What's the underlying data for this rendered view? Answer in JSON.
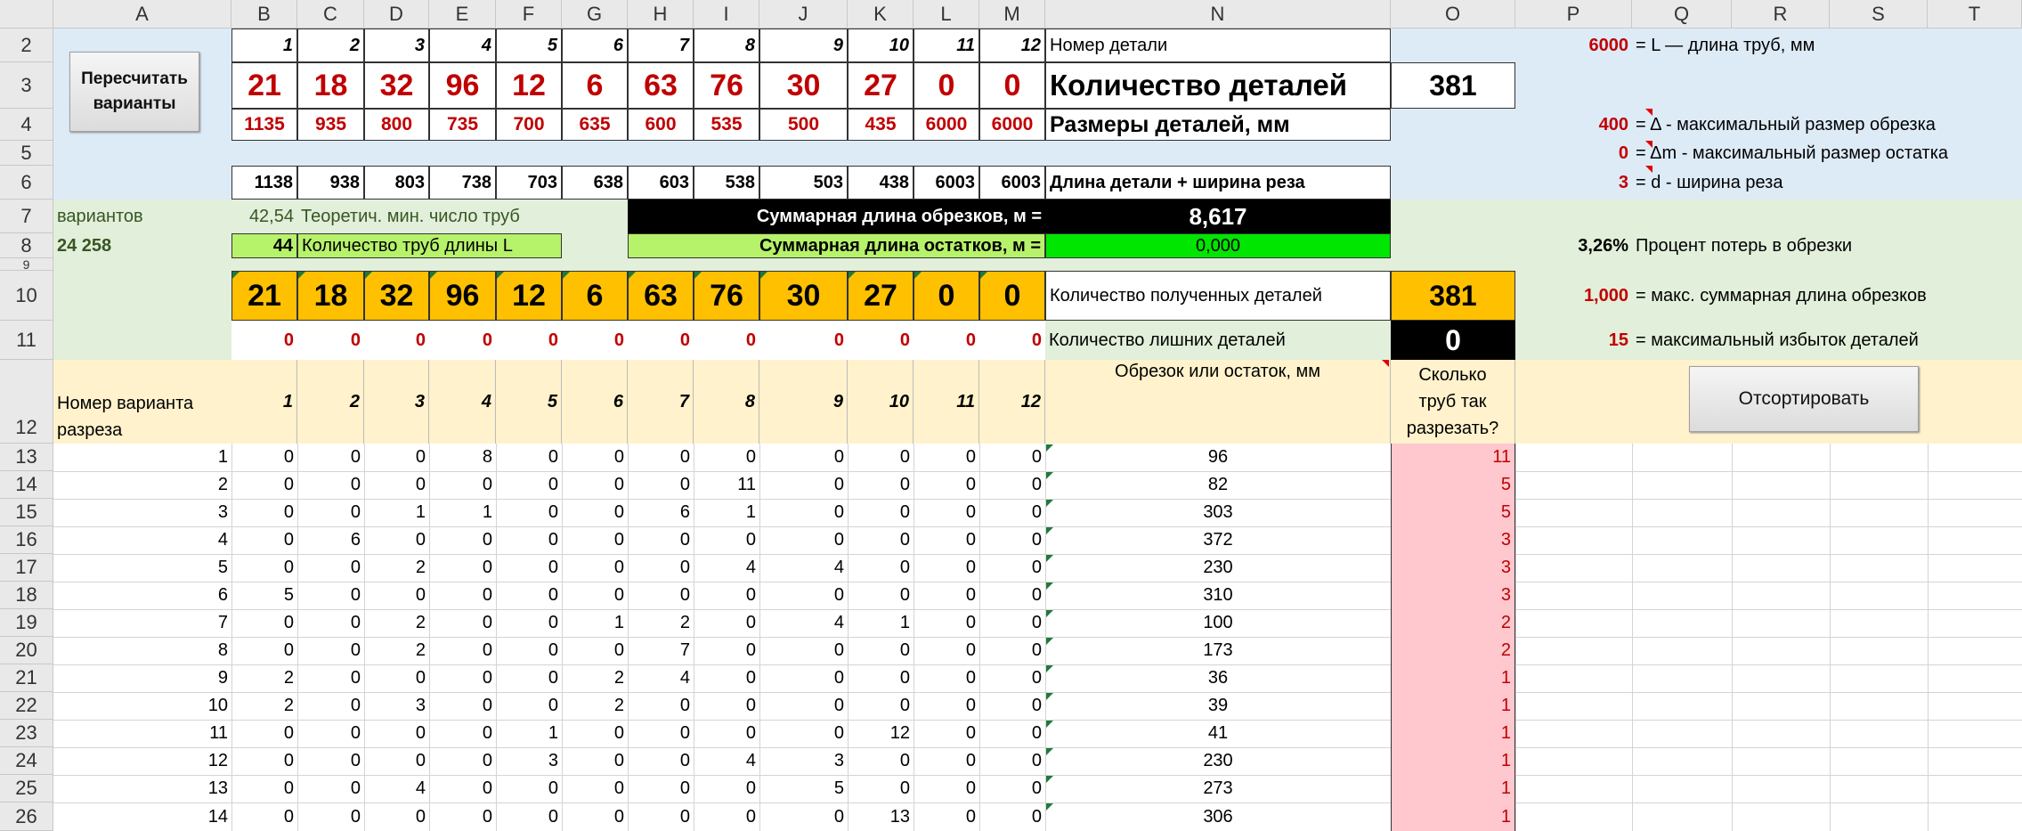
{
  "columns": [
    "A",
    "B",
    "C",
    "D",
    "E",
    "F",
    "G",
    "H",
    "I",
    "J",
    "K",
    "L",
    "M",
    "N",
    "O",
    "P",
    "Q",
    "R",
    "S",
    "T"
  ],
  "row_numbers": [
    "2",
    "3",
    "4",
    "5",
    "6",
    "7",
    "8",
    "9",
    "10",
    "11",
    "12",
    "13",
    "14",
    "15",
    "16",
    "17",
    "18",
    "19",
    "20",
    "21",
    "22",
    "23",
    "24",
    "25",
    "26"
  ],
  "buttons": {
    "recalc": "Пересчитать варианты",
    "sort": "Отсортировать"
  },
  "part_numbers": [
    "1",
    "2",
    "3",
    "4",
    "5",
    "6",
    "7",
    "8",
    "9",
    "10",
    "11",
    "12"
  ],
  "part_quantities": [
    "21",
    "18",
    "32",
    "96",
    "12",
    "6",
    "63",
    "76",
    "30",
    "27",
    "0",
    "0"
  ],
  "part_sizes": [
    "1135",
    "935",
    "800",
    "735",
    "700",
    "635",
    "600",
    "535",
    "500",
    "435",
    "6000",
    "6000"
  ],
  "part_len_kerf": [
    "1138",
    "938",
    "803",
    "738",
    "703",
    "638",
    "603",
    "538",
    "503",
    "438",
    "6003",
    "6003"
  ],
  "labels": {
    "part_number": "Номер детали",
    "part_count": "Количество деталей",
    "part_sizes": "Размеры деталей, мм",
    "len_kerf": "Длина детали + ширина реза",
    "variants_label": "вариантов",
    "variants_count": "24 258",
    "theor_value": "42,54",
    "theor_label": "Теоретич. мин. число труб",
    "pipes_value": "44",
    "pipes_label": "Количество труб длины L",
    "scrap_label": "Суммарная длина обрезков, м =",
    "scrap_value": "8,617",
    "rem_label": "Суммарная длина остатков, м =",
    "rem_value": "0,000",
    "loss_pct": "3,26%",
    "loss_label": "Процент потерь в обрезки",
    "received_label": "Количество полученных  деталей",
    "received_total": "381",
    "extra_label": "Количество лишних деталей",
    "extra_total": "0",
    "total_parts": "381"
  },
  "params": [
    {
      "value": "6000",
      "label": "= L — длина труб, мм"
    },
    {
      "value": "400",
      "label": "= Δ - максимальный размер обрезка"
    },
    {
      "value": "0",
      "label": "= Δm - максимальный размер остатка"
    },
    {
      "value": "3",
      "label": "= d - ширина реза"
    },
    {
      "value": "1,000",
      "label": "= макс. суммарная длина обрезков"
    },
    {
      "value": "15",
      "label": "= максимальный избыток деталей"
    }
  ],
  "received_counts": [
    "21",
    "18",
    "32",
    "96",
    "12",
    "6",
    "63",
    "76",
    "30",
    "27",
    "0",
    "0"
  ],
  "extra_counts": [
    "0",
    "0",
    "0",
    "0",
    "0",
    "0",
    "0",
    "0",
    "0",
    "0",
    "0",
    "0"
  ],
  "table_header": {
    "variant": "Номер варианта разреза",
    "cols": [
      "1",
      "2",
      "3",
      "4",
      "5",
      "6",
      "7",
      "8",
      "9",
      "10",
      "11",
      "12"
    ],
    "scrap": "Обрезок или остаток, мм",
    "howmany": "Сколько труб так разрезать?"
  },
  "table_rows": [
    {
      "n": "1",
      "cells": [
        "0",
        "0",
        "0",
        "8",
        "0",
        "0",
        "0",
        "0",
        "0",
        "0",
        "0",
        "0"
      ],
      "scrap": "96",
      "count": "11"
    },
    {
      "n": "2",
      "cells": [
        "0",
        "0",
        "0",
        "0",
        "0",
        "0",
        "0",
        "11",
        "0",
        "0",
        "0",
        "0"
      ],
      "scrap": "82",
      "count": "5"
    },
    {
      "n": "3",
      "cells": [
        "0",
        "0",
        "1",
        "1",
        "0",
        "0",
        "6",
        "1",
        "0",
        "0",
        "0",
        "0"
      ],
      "scrap": "303",
      "count": "5"
    },
    {
      "n": "4",
      "cells": [
        "0",
        "6",
        "0",
        "0",
        "0",
        "0",
        "0",
        "0",
        "0",
        "0",
        "0",
        "0"
      ],
      "scrap": "372",
      "count": "3"
    },
    {
      "n": "5",
      "cells": [
        "0",
        "0",
        "2",
        "0",
        "0",
        "0",
        "0",
        "4",
        "4",
        "0",
        "0",
        "0"
      ],
      "scrap": "230",
      "count": "3"
    },
    {
      "n": "6",
      "cells": [
        "5",
        "0",
        "0",
        "0",
        "0",
        "0",
        "0",
        "0",
        "0",
        "0",
        "0",
        "0"
      ],
      "scrap": "310",
      "count": "3"
    },
    {
      "n": "7",
      "cells": [
        "0",
        "0",
        "2",
        "0",
        "0",
        "1",
        "2",
        "0",
        "4",
        "1",
        "0",
        "0"
      ],
      "scrap": "100",
      "count": "2"
    },
    {
      "n": "8",
      "cells": [
        "0",
        "0",
        "2",
        "0",
        "0",
        "0",
        "7",
        "0",
        "0",
        "0",
        "0",
        "0"
      ],
      "scrap": "173",
      "count": "2"
    },
    {
      "n": "9",
      "cells": [
        "2",
        "0",
        "0",
        "0",
        "0",
        "2",
        "4",
        "0",
        "0",
        "0",
        "0",
        "0"
      ],
      "scrap": "36",
      "count": "1"
    },
    {
      "n": "10",
      "cells": [
        "2",
        "0",
        "3",
        "0",
        "0",
        "2",
        "0",
        "0",
        "0",
        "0",
        "0",
        "0"
      ],
      "scrap": "39",
      "count": "1"
    },
    {
      "n": "11",
      "cells": [
        "0",
        "0",
        "0",
        "0",
        "1",
        "0",
        "0",
        "0",
        "0",
        "12",
        "0",
        "0"
      ],
      "scrap": "41",
      "count": "1"
    },
    {
      "n": "12",
      "cells": [
        "0",
        "0",
        "0",
        "0",
        "3",
        "0",
        "0",
        "4",
        "3",
        "0",
        "0",
        "0"
      ],
      "scrap": "230",
      "count": "1"
    },
    {
      "n": "13",
      "cells": [
        "0",
        "0",
        "4",
        "0",
        "0",
        "0",
        "0",
        "0",
        "5",
        "0",
        "0",
        "0"
      ],
      "scrap": "273",
      "count": "1"
    },
    {
      "n": "14",
      "cells": [
        "0",
        "0",
        "0",
        "0",
        "0",
        "0",
        "0",
        "0",
        "0",
        "13",
        "0",
        "0"
      ],
      "scrap": "306",
      "count": "1"
    }
  ],
  "colors": {
    "blue_band": "#ddebf7",
    "green_band": "#e2efda",
    "header_band": "#fff2cc",
    "orange": "#ffc000",
    "pink": "#ffc7ce",
    "red": "#c00000"
  }
}
